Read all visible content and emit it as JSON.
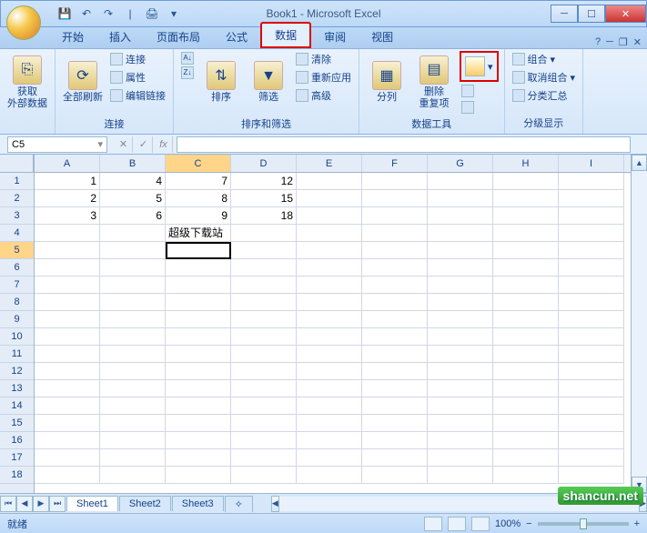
{
  "title": "Book1 - Microsoft Excel",
  "tabs": {
    "home": "开始",
    "insert": "插入",
    "page_layout": "页面布局",
    "formulas": "公式",
    "data": "数据",
    "review": "审阅",
    "view": "视图"
  },
  "ribbon": {
    "get_external": "获取\n外部数据",
    "refresh_all": "全部刷新",
    "connections": "连接",
    "properties": "属性",
    "edit_links": "编辑链接",
    "group_connections": "连接",
    "sort": "排序",
    "filter": "筛选",
    "clear": "清除",
    "reapply": "重新应用",
    "advanced": "高级",
    "group_sort_filter": "排序和筛选",
    "text_to_columns": "分列",
    "remove_duplicates": "删除\n重复项",
    "data_validation": "",
    "group_data_tools": "数据工具",
    "group_btn": "组合",
    "ungroup_btn": "取消组合",
    "subtotal": "分类汇总",
    "group_outline": "分级显示"
  },
  "name_box": "C5",
  "columns": [
    "A",
    "B",
    "C",
    "D",
    "E",
    "F",
    "G",
    "H",
    "I"
  ],
  "rows": [
    "1",
    "2",
    "3",
    "4",
    "5",
    "6",
    "7",
    "8",
    "9",
    "10",
    "11",
    "12",
    "13",
    "14",
    "15",
    "16",
    "17",
    "18"
  ],
  "cells": {
    "r1": {
      "A": "1",
      "B": "4",
      "C": "7",
      "D": "12"
    },
    "r2": {
      "A": "2",
      "B": "5",
      "C": "8",
      "D": "15"
    },
    "r3": {
      "A": "3",
      "B": "6",
      "C": "9",
      "D": "18"
    },
    "r4": {
      "C": "超级下载站"
    }
  },
  "active_cell": {
    "row": 5,
    "col": "C"
  },
  "sheets": {
    "s1": "Sheet1",
    "s2": "Sheet2",
    "s3": "Sheet3"
  },
  "status": "就绪",
  "zoom": "100%",
  "watermark": "shancun.net"
}
